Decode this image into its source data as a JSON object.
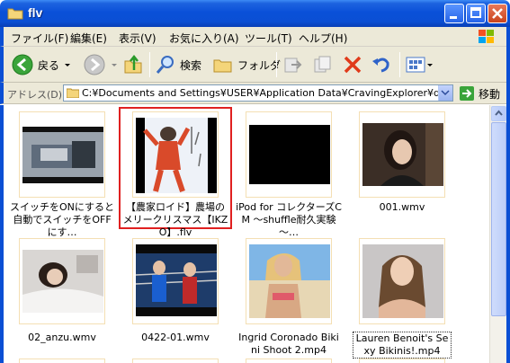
{
  "window": {
    "title": "flv"
  },
  "menu": [
    "ファイル(F)",
    "編集(E)",
    "表示(V)",
    "お気に入り(A)",
    "ツール(T)",
    "ヘルプ(H)"
  ],
  "toolbar": {
    "back": "戻る",
    "search": "検索",
    "folders": "フォルダ"
  },
  "address": {
    "label": "アドレス(D)",
    "value": "C:¥Documents and Settings¥USER¥Application Data¥CravingExplorer¥downlc",
    "go": "移動"
  },
  "files": [
    {
      "name": "スイッチをONにすると自動でスイッチをOFFにす…",
      "thumb": "gadget"
    },
    {
      "name": "【農家ロイド】農場のメリークリスマス【IKZO】.flv",
      "thumb": "dancer",
      "selected": true
    },
    {
      "name": "iPod for コレクターズCM ～shuffle耐久実験～…",
      "thumb": "black"
    },
    {
      "name": "001.wmv",
      "thumb": "girl-dark"
    },
    {
      "name": "02_anzu.wmv",
      "thumb": "bed"
    },
    {
      "name": "0422-01.wmv",
      "thumb": "ring"
    },
    {
      "name": "Ingrid Coronado Bikini Shoot 2.mp4",
      "thumb": "beach"
    },
    {
      "name": "Lauren Benoit's Sexy Bikinis!.mp4",
      "thumb": "portrait",
      "focused": true
    }
  ],
  "colors": {
    "titlebar": "#0a50d8",
    "selection": "#e02020",
    "chrome": "#ece9d8"
  }
}
